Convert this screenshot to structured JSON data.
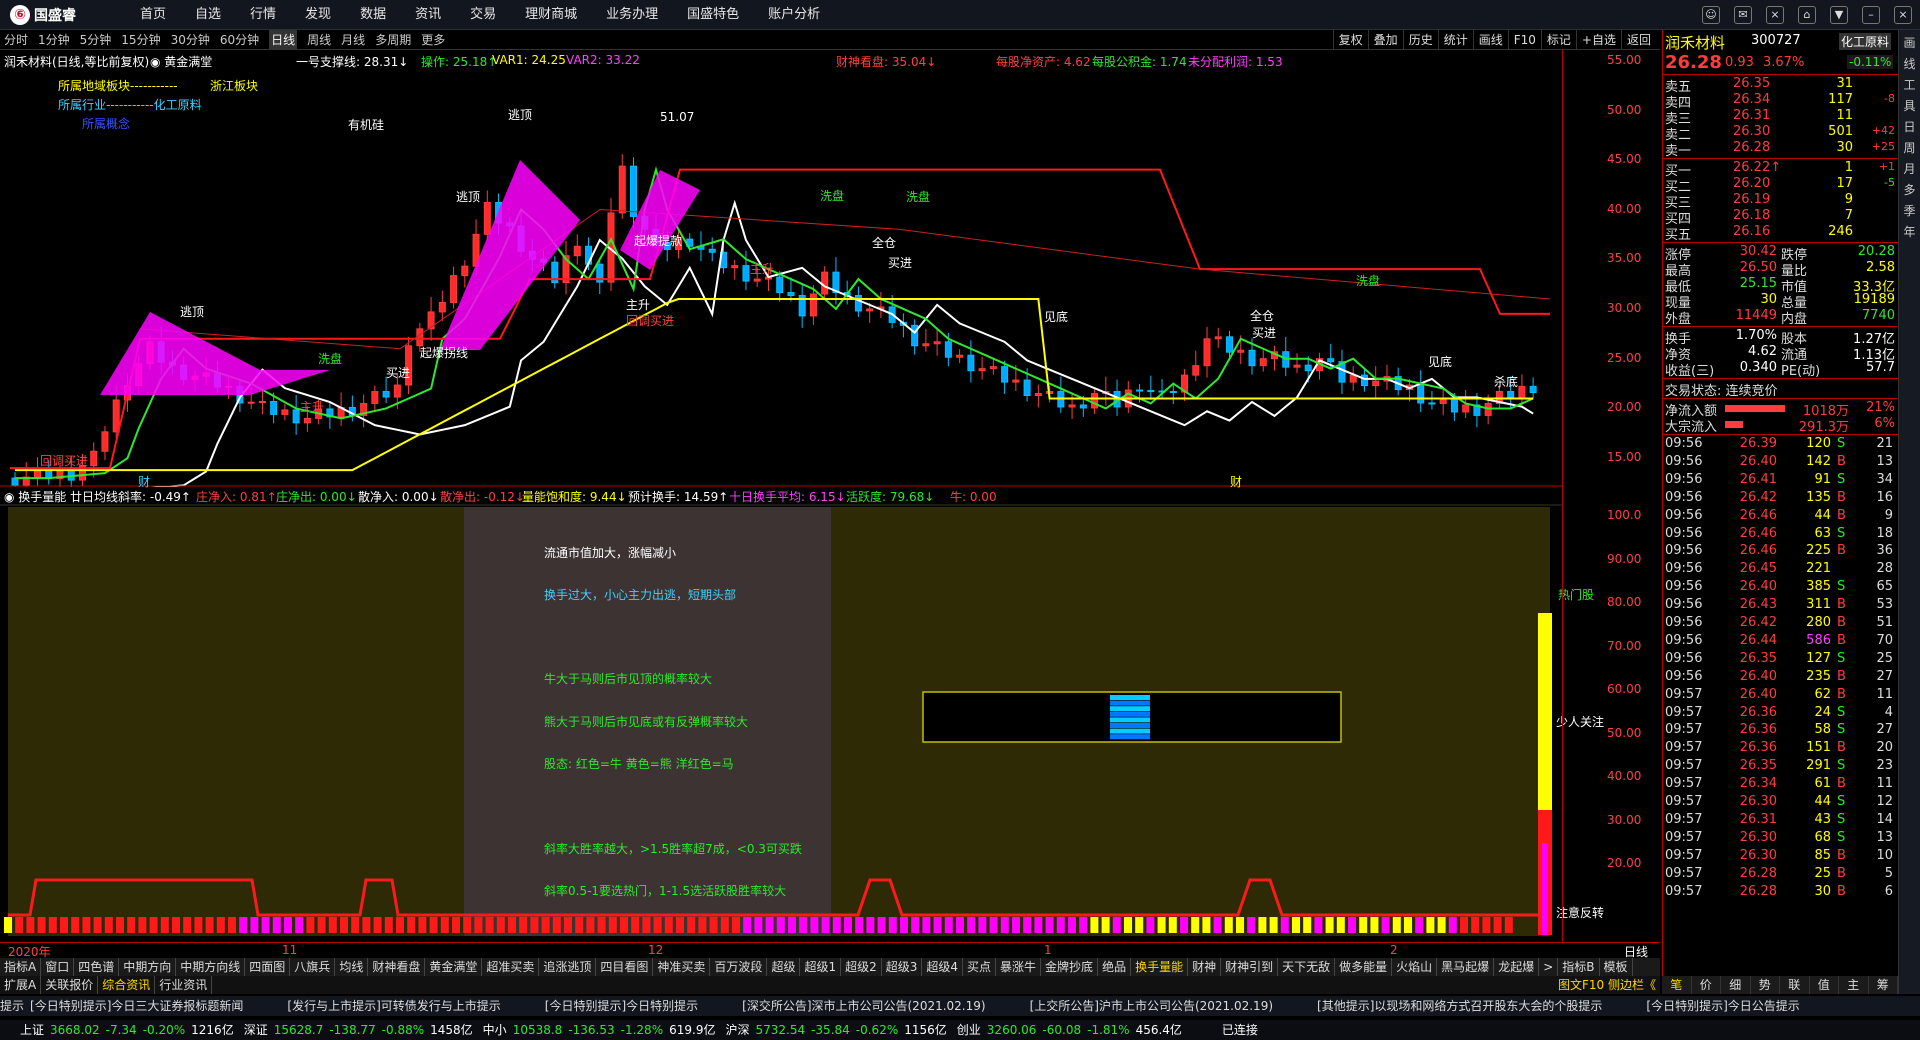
{
  "app": {
    "logo": "国盛睿",
    "nav": [
      "首页",
      "自选",
      "行情",
      "发现",
      "数据",
      "资讯",
      "交易",
      "理财商城",
      "业务办理",
      "国盛特色",
      "账户分析"
    ],
    "window_buttons": [
      "☺",
      "✉",
      "⨯",
      "⌂",
      "▼",
      "–",
      "⨯"
    ]
  },
  "period_bar": {
    "items": [
      "分时",
      "1分钟",
      "5分钟",
      "15分钟",
      "30分钟",
      "60分钟",
      "日线",
      "周线",
      "月线",
      "多周期",
      "更多"
    ],
    "active": "日线",
    "right_tools": [
      "复权",
      "叠加",
      "历史",
      "统计",
      "画线",
      "F10",
      "标记",
      "+自选",
      "返回"
    ]
  },
  "chart_header": {
    "title": "润禾材料(日线,等比前复权)",
    "sub": "◉ 黄金满堂",
    "support": "一号支撑线: 28.31↓",
    "op": "操作: 25.18↑",
    "var1": "VAR1: 24.25",
    "var2": "VAR2: 33.22",
    "caishen": "财神看盘: 35.04↓",
    "mgjz": "每股净资产: 4.62",
    "mggj": "每股公积金: 1.74",
    "wfp": "未分配利润: 1.53"
  },
  "info_box": {
    "l1": "所属地域板块-----------",
    "l1v": "浙江板块",
    "l2": "所属行业-----------化工原料",
    "l3": "所属概念",
    "l4": "有机硅"
  },
  "axis_price": [
    "55.00",
    "50.00",
    "45.00",
    "40.00",
    "35.00",
    "30.00",
    "25.00",
    "20.00",
    "15.00"
  ],
  "axis_ind": [
    "100.0",
    "90.00",
    "80.00",
    "70.00",
    "60.00",
    "50.00",
    "40.00",
    "30.00",
    "20.00"
  ],
  "chart_annotations": {
    "taoding": "逃顶",
    "hi": "51.07",
    "xipan": "洗盘",
    "zhusheng": "主升",
    "jiandi": "见底",
    "quancang": "全仓",
    "maijin": "买进",
    "qibao": "起爆拐线",
    "qibao2": "起爆提款",
    "qidian": "起点",
    "zhusheng2": "主升",
    "wuwai": "回调买进",
    "shadi": "杀底",
    "cai": "财",
    "cai2": "财"
  },
  "ind_header": {
    "name": "◉ 换手量能",
    "rate": "廿日均线斜率: -0.49↑",
    "zjr": "庄净入: 0.81↑",
    "zjc": "庄净出: 0.00↓",
    "sjr": "散净入: 0.00↓",
    "sjc": "散净出: -0.12↓",
    "lnbh": "量能饱和度: 9.44↓",
    "yjhs": "预计换手: 14.59↑",
    "srhs": "十日换手平均: 6.15↓",
    "hyd": "活跃度: 79.68↓",
    "niu": "牛: 0.00"
  },
  "ind_notes": [
    "流通市值加大，涨幅减小",
    "换手过大，小心主力出逃，短期头部",
    "牛大于马则后市见顶的概率较大",
    "熊大于马则后市见底或有反弹概率较大",
    "股态:  红色=牛    黄色=熊    洋红色=马",
    "斜率大胜率越大，>1.5胜率超7成，<0.3可买跌",
    "斜率0.5-1要选热门，1-1.5选活跃股胜率较大"
  ],
  "ind_right_labels": {
    "hot": "热门股",
    "few": "少人关注",
    "watch": "注意反转"
  },
  "date_axis": [
    "2020年",
    "11",
    "12",
    "1",
    "2"
  ],
  "date_axis_right": "日线",
  "tabs_row1": [
    "指标A",
    "窗口",
    "四色谱",
    "中期方向",
    "中期方向线",
    "四面图",
    "八旗兵",
    "均线",
    "财神看盘",
    "黄金满堂",
    "超准买卖",
    "追涨逃顶",
    "四目看图",
    "神准买卖",
    "百万波段",
    "超级",
    "超级1",
    "超级2",
    "超级3",
    "超级4",
    "买点",
    "暴涨牛",
    "金牌抄底",
    "绝品",
    "换手量能",
    "财神",
    "财神引到",
    "天下无敌",
    "做多能量",
    "火焰山",
    "黑马起爆",
    "龙起爆",
    ">",
    "指标B",
    "模板"
  ],
  "tabs_row1_active": "换手量能",
  "tabs_row2": [
    "扩展A",
    "关联报价",
    "综合资讯",
    "行业资讯"
  ],
  "tabs_row2_right": "图文F10 侧边栏《",
  "news": [
    "[今日特别提示]今日三大证券报标题新闻",
    "[发行与上市提示]可转债发行与上市提示",
    "[今日特别提示]今日特别提示",
    "[深交所公告]深市上市公司公告(2021.02.19)",
    "[上交所公告]沪市上市公司公告(2021.02.19)",
    "[其他提示]以现场和网络方式召开股东大会的个股提示",
    "[今日特别提示]今日公告提示"
  ],
  "status": [
    {
      "name": "上证",
      "price": "3668.02",
      "chg": "-7.34",
      "pct": "-0.20%",
      "amt": "1216亿"
    },
    {
      "name": "深证",
      "price": "15628.7",
      "chg": "-138.77",
      "pct": "-0.88%",
      "amt": "1458亿"
    },
    {
      "name": "中小",
      "price": "10538.8",
      "chg": "-136.53",
      "pct": "-1.28%",
      "amt": "619.9亿"
    },
    {
      "name": "沪深",
      "price": "5732.54",
      "chg": "-35.84",
      "pct": "-0.62%",
      "amt": "1156亿"
    },
    {
      "name": "创业",
      "price": "3260.06",
      "chg": "-60.08",
      "pct": "-1.81%",
      "amt": "456.4亿"
    }
  ],
  "status_conn": "已连接",
  "quote": {
    "name": "润禾材料",
    "code": "300727",
    "industry": "化工原料",
    "price": "26.28",
    "chg": "0.93",
    "pct": "3.67%",
    "ind_pct": "-0.11%",
    "asks": [
      {
        "l": "卖五",
        "p": "26.35",
        "v": "31",
        "d": ""
      },
      {
        "l": "卖四",
        "p": "26.34",
        "v": "117",
        "d": "-8"
      },
      {
        "l": "卖三",
        "p": "26.31",
        "v": "11",
        "d": ""
      },
      {
        "l": "卖二",
        "p": "26.30",
        "v": "501",
        "d": "+42"
      },
      {
        "l": "卖一",
        "p": "26.28",
        "v": "30",
        "d": "+25"
      }
    ],
    "bids": [
      {
        "l": "买一",
        "p": "26.22↑",
        "v": "1",
        "d": "+1"
      },
      {
        "l": "买二",
        "p": "26.20",
        "v": "17",
        "d": "-5"
      },
      {
        "l": "买三",
        "p": "26.19",
        "v": "9",
        "d": ""
      },
      {
        "l": "买四",
        "p": "26.18",
        "v": "7",
        "d": ""
      },
      {
        "l": "买五",
        "p": "26.16",
        "v": "246",
        "d": ""
      }
    ],
    "stats": [
      [
        "涨停",
        "30.42",
        "跌停",
        "20.28"
      ],
      [
        "最高",
        "26.50",
        "量比",
        "2.58"
      ],
      [
        "最低",
        "25.15",
        "市值",
        "33.3亿"
      ],
      [
        "现量",
        "30",
        "总量",
        "19189"
      ],
      [
        "外盘",
        "11449",
        "内盘",
        "7740"
      ]
    ],
    "stats2": [
      [
        "换手",
        "1.70%",
        "股本",
        "1.27亿"
      ],
      [
        "净资",
        "4.62",
        "流通",
        "1.13亿"
      ],
      [
        "收益(三)",
        "0.340",
        "PE(动)",
        "57.7"
      ]
    ],
    "trade_status": "交易状态: 连续竞价",
    "flows": [
      {
        "l": "净流入额",
        "v": "1018万",
        "p": "21%"
      },
      {
        "l": "大宗流入",
        "v": "291.3万",
        "p": "6%"
      }
    ]
  },
  "ticks": [
    [
      "09:56",
      "26.39",
      "120",
      "S",
      "21"
    ],
    [
      "09:56",
      "26.40",
      "142",
      "B",
      "13"
    ],
    [
      "09:56",
      "26.41",
      "91",
      "S",
      "34"
    ],
    [
      "09:56",
      "26.42",
      "135",
      "B",
      "16"
    ],
    [
      "09:56",
      "26.46",
      "44",
      "B",
      "9"
    ],
    [
      "09:56",
      "26.46",
      "63",
      "S",
      "18"
    ],
    [
      "09:56",
      "26.46",
      "225",
      "B",
      "36"
    ],
    [
      "09:56",
      "26.45",
      "221",
      "",
      "28"
    ],
    [
      "09:56",
      "26.40",
      "385",
      "S",
      "65"
    ],
    [
      "09:56",
      "26.43",
      "311",
      "B",
      "53"
    ],
    [
      "09:56",
      "26.42",
      "280",
      "B",
      "51"
    ],
    [
      "09:56",
      "26.44",
      "586",
      "B",
      "70"
    ],
    [
      "09:56",
      "26.35",
      "127",
      "S",
      "25"
    ],
    [
      "09:56",
      "26.40",
      "235",
      "B",
      "27"
    ],
    [
      "09:57",
      "26.40",
      "62",
      "B",
      "11"
    ],
    [
      "09:57",
      "26.36",
      "24",
      "S",
      "4"
    ],
    [
      "09:57",
      "26.36",
      "58",
      "S",
      "27"
    ],
    [
      "09:57",
      "26.36",
      "151",
      "B",
      "20"
    ],
    [
      "09:57",
      "26.35",
      "291",
      "S",
      "23"
    ],
    [
      "09:57",
      "26.34",
      "61",
      "B",
      "11"
    ],
    [
      "09:57",
      "26.30",
      "44",
      "S",
      "12"
    ],
    [
      "09:57",
      "26.31",
      "43",
      "S",
      "14"
    ],
    [
      "09:57",
      "26.30",
      "68",
      "S",
      "13"
    ],
    [
      "09:57",
      "26.30",
      "85",
      "B",
      "10"
    ],
    [
      "09:57",
      "26.28",
      "25",
      "B",
      "5"
    ],
    [
      "09:57",
      "26.28",
      "30",
      "B",
      "6"
    ]
  ],
  "right_side": [
    "画",
    "线",
    "工",
    "具",
    "日",
    "周",
    "月",
    "多",
    "季",
    "年"
  ],
  "right_tabs": [
    "笔",
    "价",
    "细",
    "势",
    "联",
    "值",
    "主",
    "筹"
  ],
  "right_tabs_active": "笔",
  "colors": {
    "up": "#ff3c3c",
    "down": "#00ffff",
    "bg": "#000000",
    "axis": "#b00000",
    "yellow": "#ffff00",
    "magenta": "#ff00ff"
  }
}
